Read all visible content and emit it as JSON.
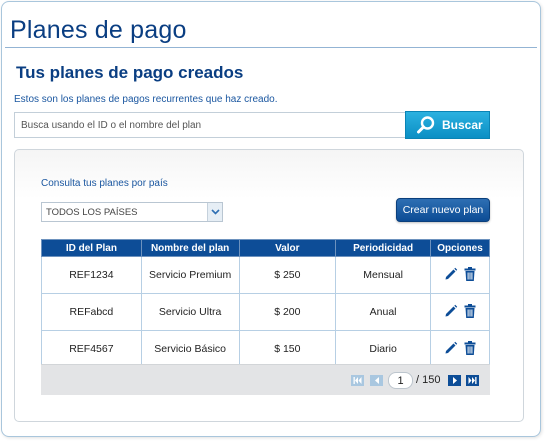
{
  "page": {
    "title": "Planes de pago",
    "subtitle": "Tus planes de pago creados",
    "description": "Estos son los planes de pagos recurrentes que haz creado."
  },
  "search": {
    "placeholder": "Busca usando el ID o el nombre del plan",
    "button_label": "Buscar"
  },
  "filters": {
    "country_label": "Consulta tus planes por país",
    "country_selected": "TODOS LOS PAÍSES"
  },
  "create_button_label": "Crear nuevo plan",
  "table": {
    "headers": [
      "ID del Plan",
      "Nombre del plan",
      "Valor",
      "Periodicidad",
      "Opciones"
    ],
    "rows": [
      {
        "id": "REF1234",
        "name": "Servicio Premium",
        "value": "$ 250",
        "period": "Mensual"
      },
      {
        "id": "REFabcd",
        "name": "Servicio Ultra",
        "value": "$ 200",
        "period": "Anual"
      },
      {
        "id": "REF4567",
        "name": "Servicio Básico",
        "value": "$ 150",
        "period": "Diario"
      }
    ],
    "row_icons": [
      "pencil-icon",
      "trash-icon"
    ]
  },
  "pagination": {
    "current_page": "1",
    "total_label": "/ 150"
  },
  "colors": {
    "primary": "#0d4d97",
    "title": "#0a3e82",
    "search_button": "#1aa3d6"
  }
}
